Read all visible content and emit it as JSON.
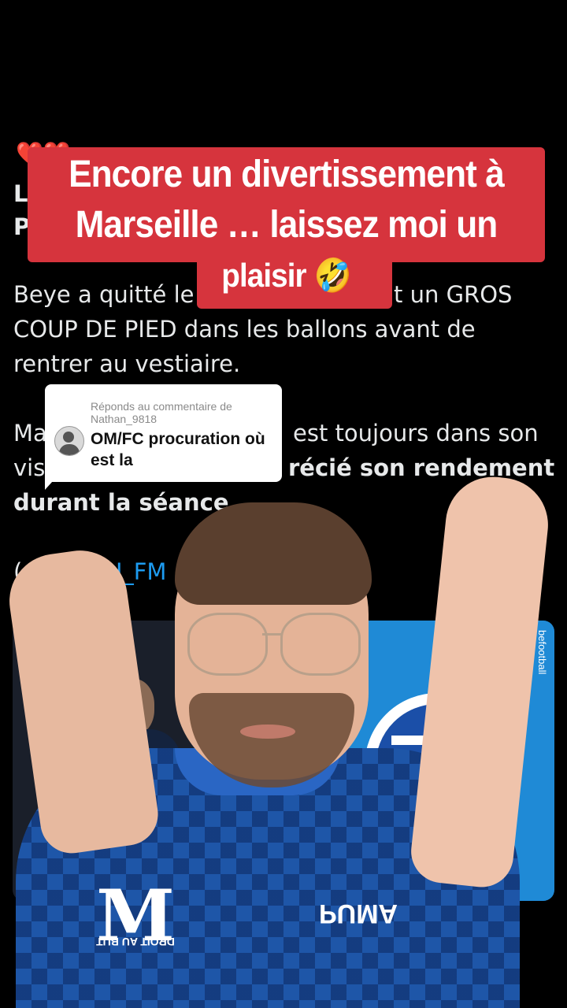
{
  "overlay_title": {
    "line1": "Encore un divertissement à",
    "line2": "Marseille … laissez moi un",
    "line3": "plaisir",
    "emoji": "🤣"
  },
  "reply_bubble": {
    "header": "Réponds au commentaire de Nathan_9818",
    "comment": "OM/FC procuration où est la"
  },
  "tweet": {
    "hearts": "❤️❤️",
    "line_a1": "L",
    "line_a2": "P",
    "line1_part1": "Beye a quitté le",
    "line1_part2": "t un GROS",
    "line2": "COUP DE PIED dans les ballons avant de",
    "line3": "rentrer au vestiaire.",
    "line4_part1": "Ma",
    "line4_part2": "est toujours dans son",
    "line5_part1": "vis",
    "line5_part2": "récié son rendement",
    "line6": "durant la séance",
    "line6_end": ".",
    "line7_open": "(",
    "line7_mention": "@S",
    "line7_mention_end": "U_FM",
    "line7_slash": "/"
  },
  "background_card": {
    "brand": "befootball"
  },
  "jersey": {
    "brand": "PUMA",
    "club_text": "DROIT AU BUT"
  },
  "colors": {
    "banner": "#d6343d",
    "mention": "#1d9bf0",
    "jersey": "#1e56a8"
  }
}
